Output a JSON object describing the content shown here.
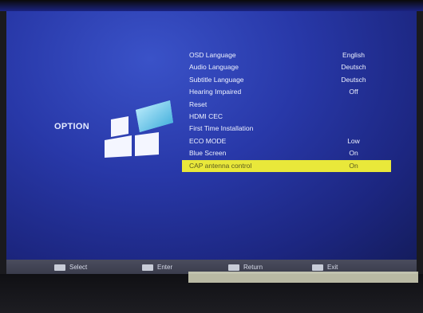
{
  "menu": {
    "title": "OPTION",
    "items": [
      {
        "label": "OSD Language",
        "value": "English"
      },
      {
        "label": "Audio Language",
        "value": "Deutsch"
      },
      {
        "label": "Subtitle Language",
        "value": "Deutsch"
      },
      {
        "label": "Hearing Impaired",
        "value": "Off"
      },
      {
        "label": "Reset",
        "value": ""
      },
      {
        "label": "HDMI CEC",
        "value": ""
      },
      {
        "label": "First Time Installation",
        "value": ""
      },
      {
        "label": "ECO MODE",
        "value": "Low"
      },
      {
        "label": "Blue Screen",
        "value": "On"
      },
      {
        "label": "CAP antenna control",
        "value": "On"
      }
    ],
    "selected_index": 9
  },
  "hints": [
    {
      "key": "select-key-icon",
      "label": "Select"
    },
    {
      "key": "enter-key-icon",
      "label": "Enter"
    },
    {
      "key": "return-key-icon",
      "label": "Return"
    },
    {
      "key": "exit-key-icon",
      "label": "Exit"
    }
  ],
  "colors": {
    "background": "#2838a8",
    "highlight": "#e9e83a",
    "text": "#eef2ff"
  }
}
